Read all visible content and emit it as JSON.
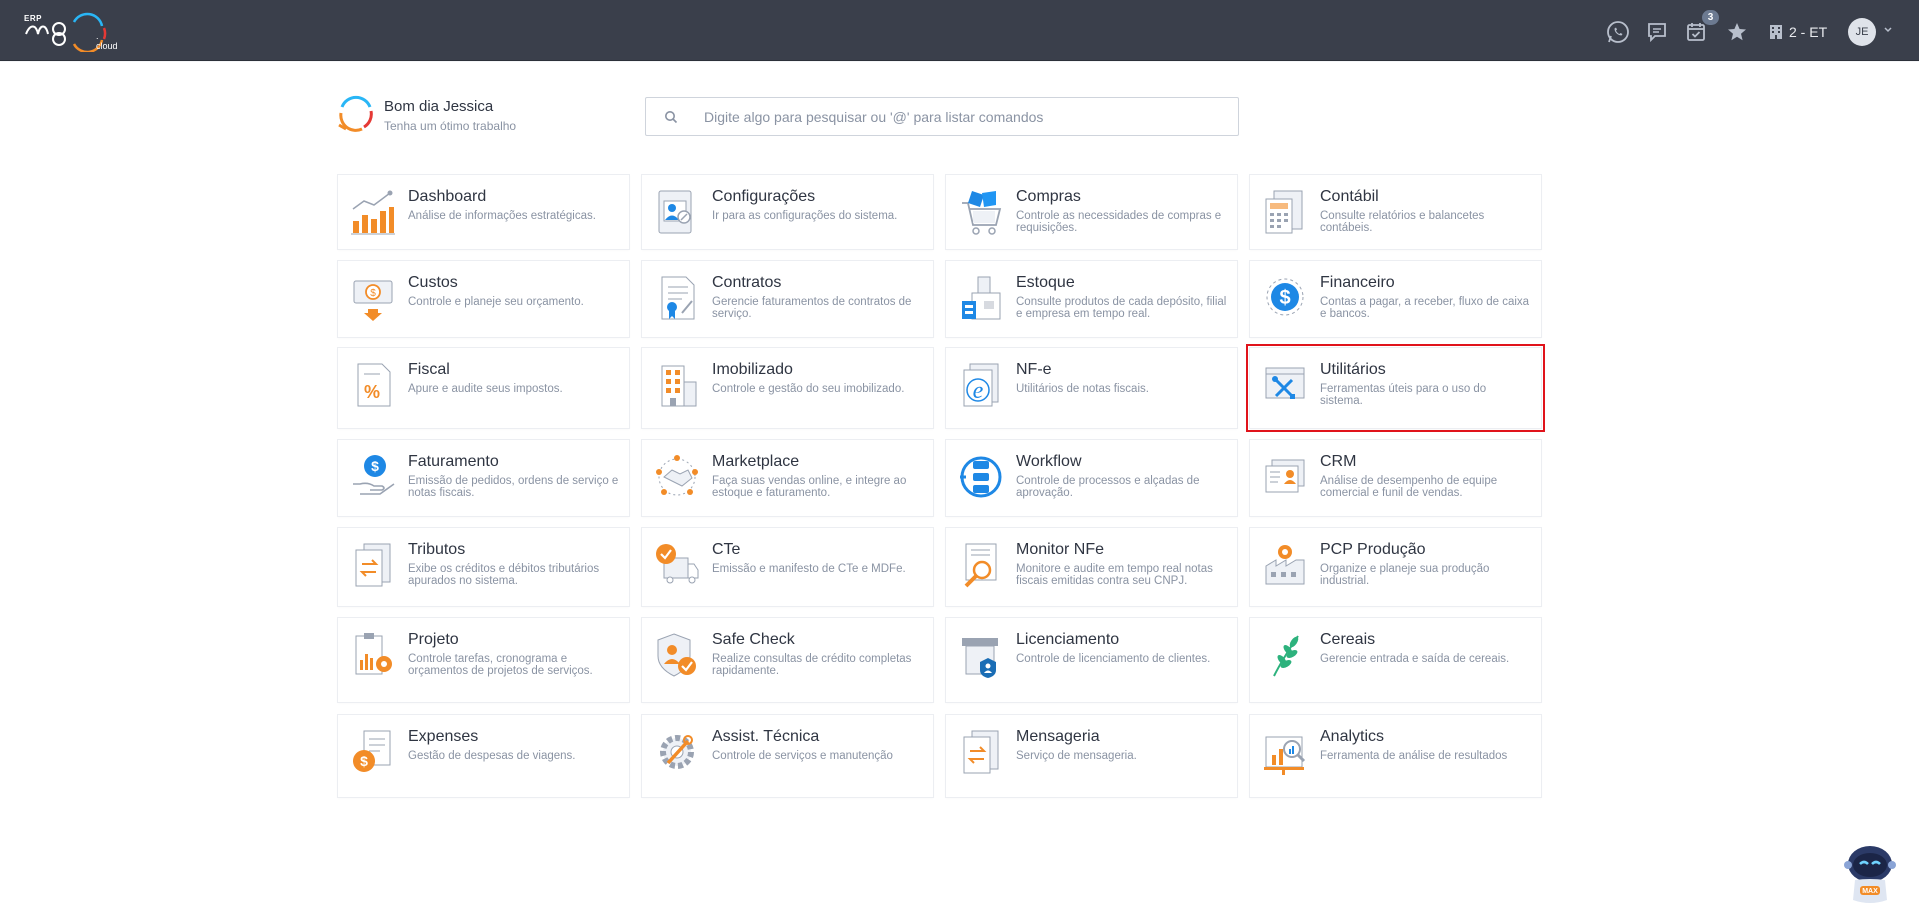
{
  "topbar": {
    "logo_erp": "ERP",
    "logo_cloud": ". cloud",
    "notifications_count": "3",
    "company": "2 - ET",
    "avatar_initials": "JE"
  },
  "greeting": {
    "title": "Bom dia Jessica",
    "subtitle": "Tenha um ótimo trabalho"
  },
  "search": {
    "placeholder": "Digite algo para pesquisar ou '@' para listar comandos",
    "value": ""
  },
  "modules": [
    {
      "title": "Dashboard",
      "desc": "Análise de informações estratégicas."
    },
    {
      "title": "Configurações",
      "desc": "Ir para as configurações do sistema."
    },
    {
      "title": "Compras",
      "desc": "Controle as necessidades de compras e requisições."
    },
    {
      "title": "Contábil",
      "desc": "Consulte relatórios e balancetes contábeis."
    },
    {
      "title": "Custos",
      "desc": "Controle e planeje seu orçamento."
    },
    {
      "title": "Contratos",
      "desc": "Gerencie faturamentos de contratos de serviço."
    },
    {
      "title": "Estoque",
      "desc": "Consulte produtos de cada depósito, filial e empresa em tempo real."
    },
    {
      "title": "Financeiro",
      "desc": "Contas a pagar, a receber, fluxo de caixa e bancos."
    },
    {
      "title": "Fiscal",
      "desc": "Apure e audite seus impostos."
    },
    {
      "title": "Imobilizado",
      "desc": "Controle e gestão do seu imobilizado."
    },
    {
      "title": "NF-e",
      "desc": "Utilitários de notas fiscais."
    },
    {
      "title": "Utilitários",
      "desc": "Ferramentas úteis para o uso do sistema."
    },
    {
      "title": "Faturamento",
      "desc": "Emissão de pedidos, ordens de serviço e notas fiscais."
    },
    {
      "title": "Marketplace",
      "desc": "Faça suas vendas online, e integre ao estoque e faturamento."
    },
    {
      "title": "Workflow",
      "desc": "Controle de processos e alçadas de aprovação."
    },
    {
      "title": "CRM",
      "desc": "Análise de desempenho de equipe comercial e funil de vendas."
    },
    {
      "title": "Tributos",
      "desc": "Exibe os créditos e débitos tributários apurados no sistema."
    },
    {
      "title": "CTe",
      "desc": "Emissão e manifesto de CTe e MDFe."
    },
    {
      "title": "Monitor NFe",
      "desc": "Monitore e audite em tempo real notas fiscais emitidas contra seu CNPJ."
    },
    {
      "title": "PCP Produção",
      "desc": "Organize e planeje sua produção industrial."
    },
    {
      "title": "Projeto",
      "desc": "Controle tarefas, cronograma e orçamentos de projetos de serviços."
    },
    {
      "title": "Safe Check",
      "desc": "Realize consultas de crédito completas rapidamente."
    },
    {
      "title": "Licenciamento",
      "desc": "Controle de licenciamento de clientes."
    },
    {
      "title": "Cereais",
      "desc": "Gerencie entrada e saída de cereais."
    },
    {
      "title": "Expenses",
      "desc": "Gestão de despesas de viagens."
    },
    {
      "title": "Assist. Técnica",
      "desc": "Controle de serviços e manutenção"
    },
    {
      "title": "Mensageria",
      "desc": "Serviço de mensageria."
    },
    {
      "title": "Analytics",
      "desc": "Ferramenta de análise de resultados"
    }
  ],
  "assistant": {
    "label": "MAX"
  },
  "colors": {
    "topbar": "#3a3f4b",
    "accent_orange": "#f28c28",
    "accent_blue": "#1e88e5",
    "highlight": "#e0131b"
  }
}
